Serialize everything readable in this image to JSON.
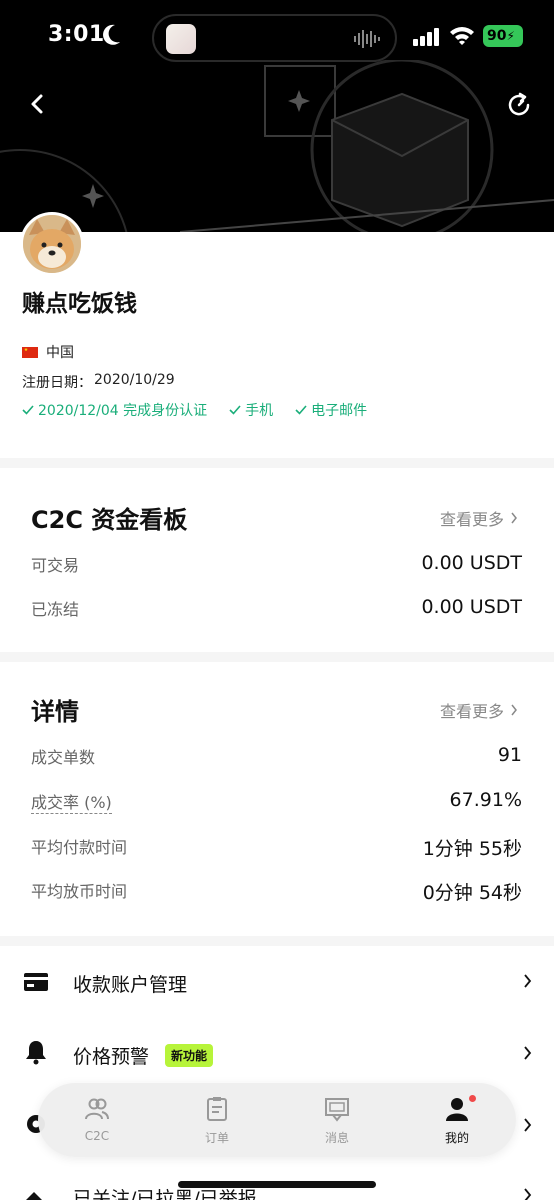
{
  "status_bar": {
    "time": "3:01",
    "battery": "90"
  },
  "profile": {
    "nickname": "赚点吃饭钱",
    "country": "中国",
    "register_label": "注册日期：",
    "register_date": "2020/10/29",
    "verifications": [
      "2020/12/04 完成身份认证",
      "手机",
      "电子邮件"
    ]
  },
  "funds_card": {
    "title": "C2C 资金看板",
    "more": "查看更多",
    "rows": [
      {
        "label": "可交易",
        "value": "0.00 USDT"
      },
      {
        "label": "已冻结",
        "value": "0.00 USDT"
      }
    ]
  },
  "details_card": {
    "title": "详情",
    "more": "查看更多",
    "rows": [
      {
        "label": "成交单数",
        "value": "91"
      },
      {
        "label": "成交率 (%)",
        "value": "67.91%"
      },
      {
        "label": "平均付款时间",
        "value": "1分钟 55秒"
      },
      {
        "label": "平均放币时间",
        "value": "0分钟 54秒"
      }
    ]
  },
  "menu": {
    "items": [
      {
        "label": "收款账户管理",
        "icon": "wallet-icon"
      },
      {
        "label": "价格预警",
        "icon": "bell-icon",
        "badge": "新功能"
      },
      {
        "label": "",
        "icon": "gear-icon"
      },
      {
        "label": "已关注/已拉黑/已举报",
        "icon": "follow-icon"
      }
    ]
  },
  "tabbar": {
    "tabs": [
      {
        "label": "C2C",
        "icon": "users-icon"
      },
      {
        "label": "订单",
        "icon": "order-icon"
      },
      {
        "label": "消息",
        "icon": "message-icon"
      },
      {
        "label": "我的",
        "icon": "profile-icon",
        "active": true
      }
    ]
  },
  "colors": {
    "accent_green": "#1aae7a",
    "badge_lime": "#b7f43a",
    "header_black": "#000000",
    "notify_red": "#f04a4a"
  }
}
